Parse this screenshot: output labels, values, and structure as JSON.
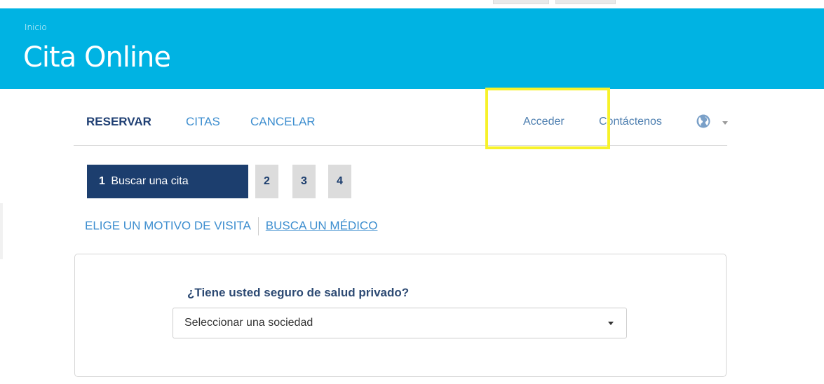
{
  "header": {
    "breadcrumb": "Inicio",
    "title": "Cita Online",
    "color": "#00b3e3"
  },
  "nav": {
    "primary": [
      {
        "label": "RESERVAR",
        "active": true
      },
      {
        "label": "CITAS",
        "active": false
      },
      {
        "label": "CANCELAR",
        "active": false
      }
    ],
    "secondary": [
      {
        "label": "Acceder"
      },
      {
        "label": "Contáctenos"
      }
    ],
    "language_icon": "globe-icon"
  },
  "steps": {
    "active": {
      "number": "1",
      "label": "Buscar una cita"
    },
    "others": [
      "2",
      "3",
      "4"
    ]
  },
  "filters": {
    "motive": "ELIGE UN MOTIVO DE VISITA",
    "doctor": "BUSCA UN MÉDICO"
  },
  "insurance": {
    "question": "¿Tiene usted seguro de salud privado?",
    "select_value": "Seleccionar una sociedad"
  },
  "colors": {
    "navy": "#1c3e6e",
    "link": "#3d8ecf",
    "highlight": "#f7f22a"
  }
}
